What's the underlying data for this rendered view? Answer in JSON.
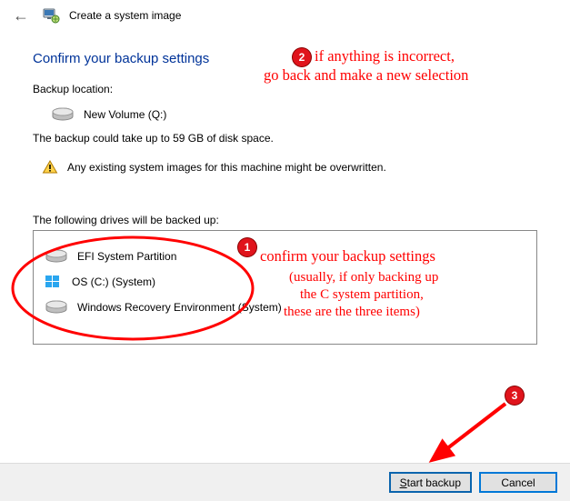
{
  "window": {
    "title": "Create a system image"
  },
  "heading": "Confirm your backup settings",
  "backup_location_label": "Backup location:",
  "backup_location_value": "New Volume (Q:)",
  "size_estimate": "The backup could take up to 59 GB of disk space.",
  "warning": "Any existing system images for this machine might be overwritten.",
  "drives_label": "The following drives will be backed up:",
  "drives": [
    {
      "name": "EFI System Partition"
    },
    {
      "name": "OS (C:) (System)"
    },
    {
      "name": "Windows Recovery Environment (System)"
    }
  ],
  "buttons": {
    "start": "Start backup",
    "cancel": "Cancel"
  },
  "annotations": {
    "n1": "1",
    "n2": "2",
    "n3": "3",
    "text2a": "if anything is incorrect,",
    "text2b": "go back and make a new selection",
    "text1a": "confirm your backup settings",
    "text1b": "(usually, if only backing up",
    "text1c": "the C system partition,",
    "text1d": "these are the three items)"
  }
}
